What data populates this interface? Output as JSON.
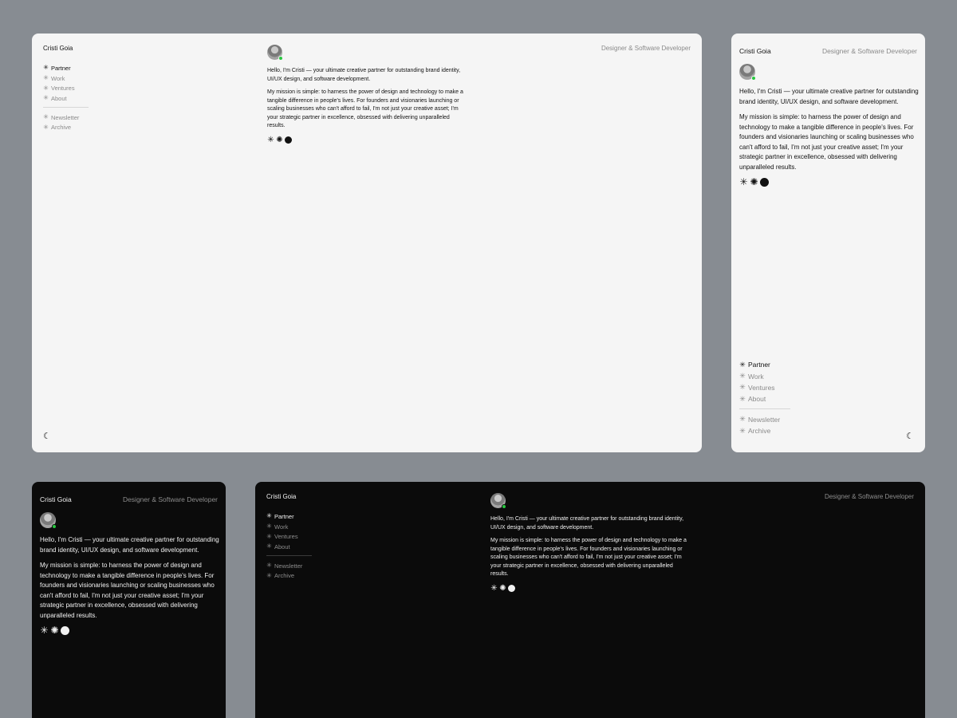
{
  "profile": {
    "name": "Cristi Goia",
    "tagline": "Designer & Software Developer",
    "intro": "Hello, I'm Cristi — your ultimate creative partner for outstanding brand identity, UI/UX design, and software development.",
    "mission": "My mission is simple: to harness the power of design and technology to make a tangible difference in people's lives. For founders and visionaries launching or scaling businesses who can't afford to fail, I'm not just your creative asset; I'm your strategic partner in excellence, obsessed with delivering unparalleled results."
  },
  "nav": {
    "primary": [
      {
        "label": "Partner",
        "active": true
      },
      {
        "label": "Work",
        "active": false
      },
      {
        "label": "Ventures",
        "active": false
      },
      {
        "label": "About",
        "active": false
      }
    ],
    "secondary": [
      {
        "label": "Newsletter"
      },
      {
        "label": "Archive"
      }
    ]
  },
  "icons": {
    "nav_bullet": "asterisk-icon",
    "row": [
      "asterisk-icon",
      "starburst-icon",
      "dot-icon"
    ],
    "theme_toggle": "moon-icon",
    "status": "online"
  },
  "colors": {
    "background": "#878c92",
    "light_surface": "#f5f5f5",
    "dark_surface": "#0b0b0b",
    "online": "#28c840"
  }
}
